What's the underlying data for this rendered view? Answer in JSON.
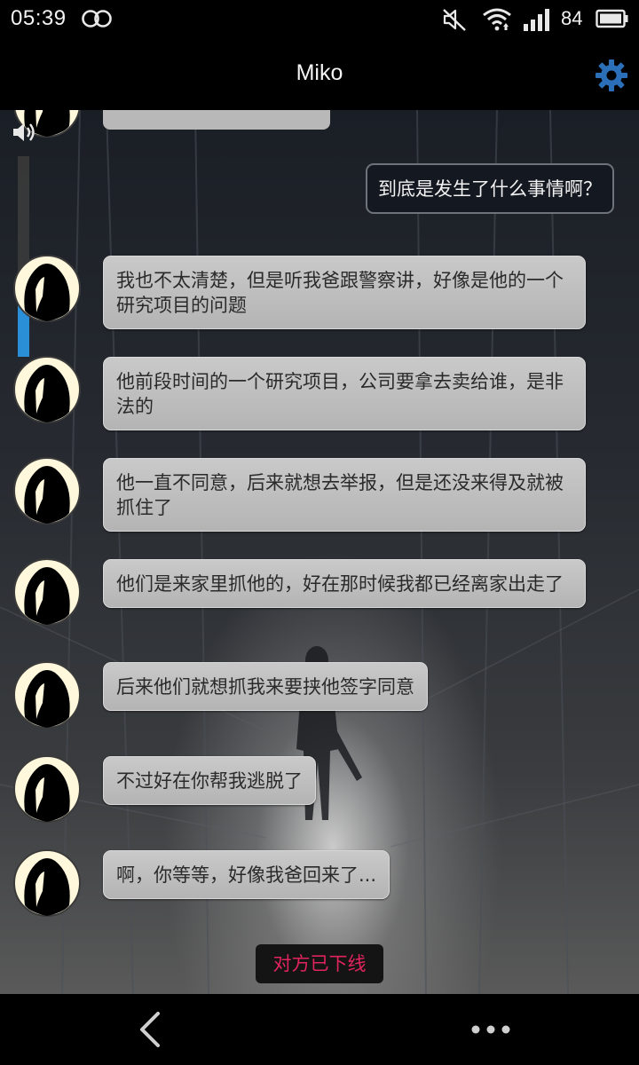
{
  "status_bar": {
    "time": "05:39",
    "battery": "84",
    "icons": [
      "dual-ring-icon",
      "mute-icon",
      "wifi-icon",
      "signal-icon",
      "battery-icon"
    ]
  },
  "header": {
    "title": "Miko",
    "settings_icon": "gear-icon",
    "accent": "#2b6fb8"
  },
  "chat": {
    "outgoing": [
      {
        "text": "到底是发生了什么事情啊？"
      }
    ],
    "incoming": [
      {
        "text": "我也不太清楚，但是听我爸跟警察讲，好像是他的一个研究项目的问题"
      },
      {
        "text": "他前段时间的一个研究项目，公司要拿去卖给谁，是非法的"
      },
      {
        "text": "他一直不同意，后来就想去举报，但是还没来得及就被抓住了"
      },
      {
        "text": "他们是来家里抓他的，好在那时候我都已经离家出走了"
      },
      {
        "text": "后来他们就想抓我来要挟他签字同意"
      },
      {
        "text": "不过好在你帮我逃脱了"
      },
      {
        "text": "啊，你等等，好像我爸回来了..."
      }
    ],
    "status_notice": "对方已下线",
    "volume_level": 0.27
  },
  "navbar": {
    "back_icon": "chevron-left-icon",
    "more_icon": "more-dots-icon"
  },
  "colors": {
    "incoming_bubble": "#bdbdbd",
    "outgoing_bubble": "#141820",
    "offline_text": "#e0245e",
    "volume_fill": "#2b8fd8"
  }
}
